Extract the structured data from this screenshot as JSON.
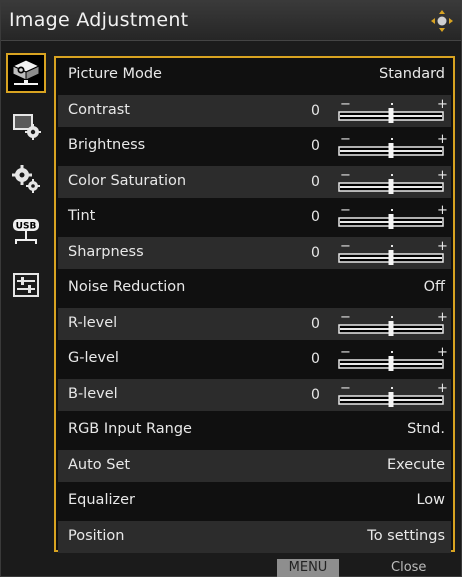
{
  "title": "Image Adjustment",
  "colors": {
    "accent": "#d8a321",
    "row_alt": "#2c2c2c",
    "panel_bg": "#101010"
  },
  "sidebar": {
    "items": [
      {
        "icon": "projector-icon",
        "active": true
      },
      {
        "icon": "monitor-settings-icon",
        "active": false
      },
      {
        "icon": "gears-icon",
        "active": false
      },
      {
        "icon": "usb-icon",
        "active": false,
        "text": "USB"
      },
      {
        "icon": "sliders-icon",
        "active": false
      }
    ]
  },
  "menu": {
    "rows": [
      {
        "label": "Picture Mode",
        "value": "Standard"
      },
      {
        "label": "Contrast",
        "number": "0",
        "slider_level": 0.5
      },
      {
        "label": "Brightness",
        "number": "0",
        "slider_level": 0.5
      },
      {
        "label": "Color Saturation",
        "number": "0",
        "slider_level": 0.5
      },
      {
        "label": "Tint",
        "number": "0",
        "slider_level": 0.5
      },
      {
        "label": "Sharpness",
        "number": "0",
        "slider_level": 0.5
      },
      {
        "label": "Noise Reduction",
        "value": "Off"
      },
      {
        "label": "R-level",
        "number": "0",
        "slider_level": 0.5
      },
      {
        "label": "G-level",
        "number": "0",
        "slider_level": 0.5
      },
      {
        "label": "B-level",
        "number": "0",
        "slider_level": 0.5
      },
      {
        "label": "RGB Input Range",
        "value": "Stnd."
      },
      {
        "label": "Auto Set",
        "value": "Execute"
      },
      {
        "label": "Equalizer",
        "value": "Low"
      },
      {
        "label": "Position",
        "value": "To settings"
      }
    ]
  },
  "slider": {
    "minus": "−",
    "plus": "+"
  },
  "footer": {
    "menu_key": "MENU",
    "close": "Close"
  }
}
